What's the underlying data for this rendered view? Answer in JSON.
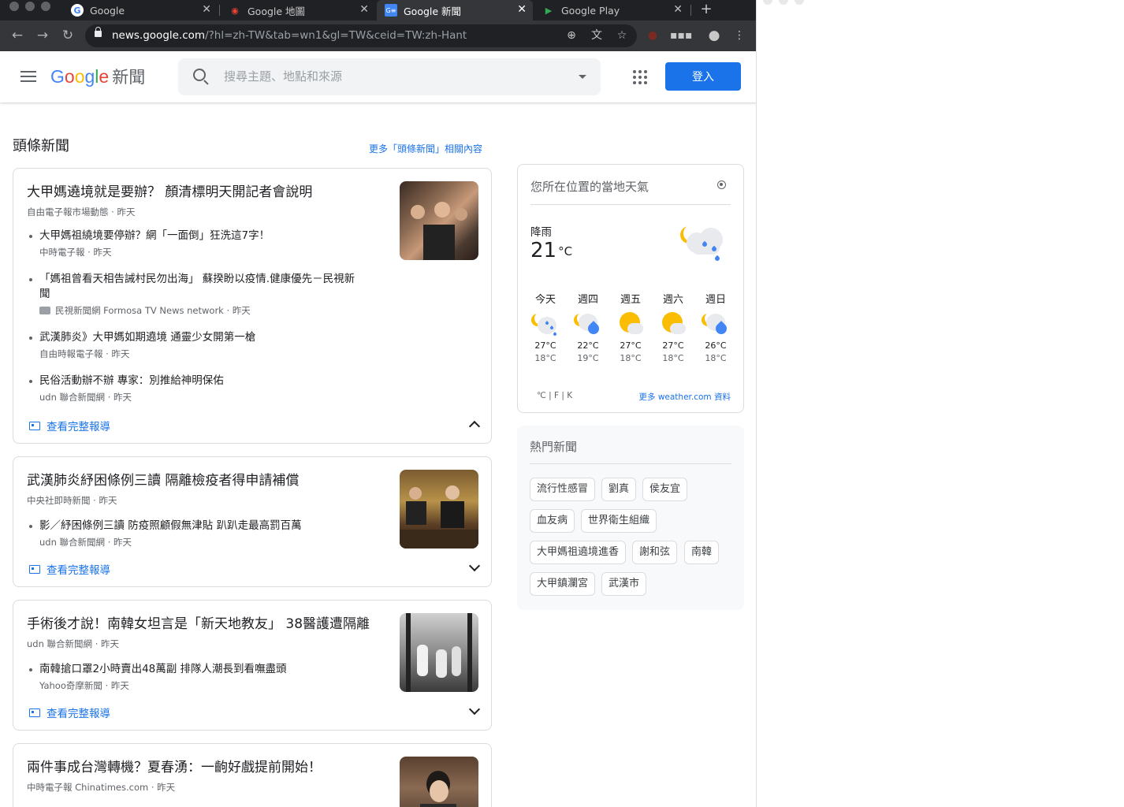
{
  "browser": {
    "tabs": [
      {
        "label": "Google",
        "active": false
      },
      {
        "label": "Google 地圖",
        "active": false
      },
      {
        "label": "Google 新聞",
        "active": true
      },
      {
        "label": "Google Play",
        "active": false
      }
    ],
    "url_host": "news.google.com",
    "url_rest": "/?hl=zh-TW&tab=wn1&gl=TW&ceid=TW:zh-Hant"
  },
  "header": {
    "logo_news": "新聞",
    "search_placeholder": "搜尋主題、地點和來源",
    "signin_label": "登入"
  },
  "main": {
    "section_title": "頭條新聞",
    "more_link": "更多「頭條新聞」相關內容",
    "full_coverage_label": "查看完整報導",
    "stories": [
      {
        "headline": "大甲媽遶境就是要辦？ 顏清標明天開記者會說明",
        "source": "自由電子報市場動態",
        "time": "昨天",
        "expanded": true,
        "subs": [
          {
            "title": "大甲媽祖繞境要停辦？網「一面倒」狂洗這7字！",
            "source": "中時電子報",
            "time": "昨天"
          },
          {
            "title": "「媽祖曾看天相告誡村民勿出海」 蘇揆盼以疫情.健康優先－民視新聞",
            "source": "民視新聞網 Formosa TV News network",
            "time": "昨天"
          },
          {
            "title": "武漢肺炎》大甲媽如期遶境 通靈少女開第一槍",
            "source": "自由時報電子報",
            "time": "昨天"
          },
          {
            "title": "民俗活動辦不辦 專家：別推給神明保佑",
            "source": "udn 聯合新聞網",
            "time": "昨天"
          }
        ]
      },
      {
        "headline": "武漢肺炎紓困條例三讀 隔離檢疫者得申請補償",
        "source": "中央社即時新聞",
        "time": "昨天",
        "expanded": false,
        "subs": [
          {
            "title": "影／紓困條例三讀 防疫照顧假無津貼 趴趴走最高罰百萬",
            "source": "udn 聯合新聞網",
            "time": "昨天"
          }
        ]
      },
      {
        "headline": "手術後才說！南韓女坦言是「新天地教友」 38醫護遭隔離",
        "source": "udn 聯合新聞網",
        "time": "昨天",
        "expanded": false,
        "subs": [
          {
            "title": "南韓搶口罩2小時賣出48萬副 排隊人潮長到看嘸盡頭",
            "source": "Yahoo奇摩新聞",
            "time": "昨天"
          }
        ]
      },
      {
        "headline": "兩件事成台灣轉機？夏春湧：一齣好戲提前開始！",
        "source": "中時電子報 Chinatimes.com",
        "time": "昨天",
        "expanded": false,
        "subs": []
      }
    ]
  },
  "weather": {
    "title": "您所在位置的當地天氣",
    "condition": "降雨",
    "temp": "21",
    "unit": "°C",
    "days": [
      {
        "name": "今天",
        "hi": "27°C",
        "lo": "18°C",
        "icon": "moon-cloud-rain-icon"
      },
      {
        "name": "週四",
        "hi": "22°C",
        "lo": "19°C",
        "icon": "moon-cloud-heavy-rain-icon"
      },
      {
        "name": "週五",
        "hi": "27°C",
        "lo": "18°C",
        "icon": "sun-cloud-icon"
      },
      {
        "name": "週六",
        "hi": "27°C",
        "lo": "18°C",
        "icon": "sun-cloud-icon"
      },
      {
        "name": "週日",
        "hi": "26°C",
        "lo": "18°C",
        "icon": "moon-cloud-heavy-rain-icon"
      }
    ],
    "units": "℃ | F | K",
    "more_link": "更多 weather.com 資料"
  },
  "trending": {
    "title": "熱門新聞",
    "chips": [
      "流行性感冒",
      "劉真",
      "侯友宜",
      "血友病",
      "世界衛生組織",
      "大甲媽祖遶境進香",
      "謝和弦",
      "南韓",
      "大甲鎮瀾宮",
      "武漢市"
    ]
  },
  "colors": {
    "accent": "#1a73e8",
    "chrome_dark": "#202124",
    "chrome_toolbar": "#35363a"
  }
}
